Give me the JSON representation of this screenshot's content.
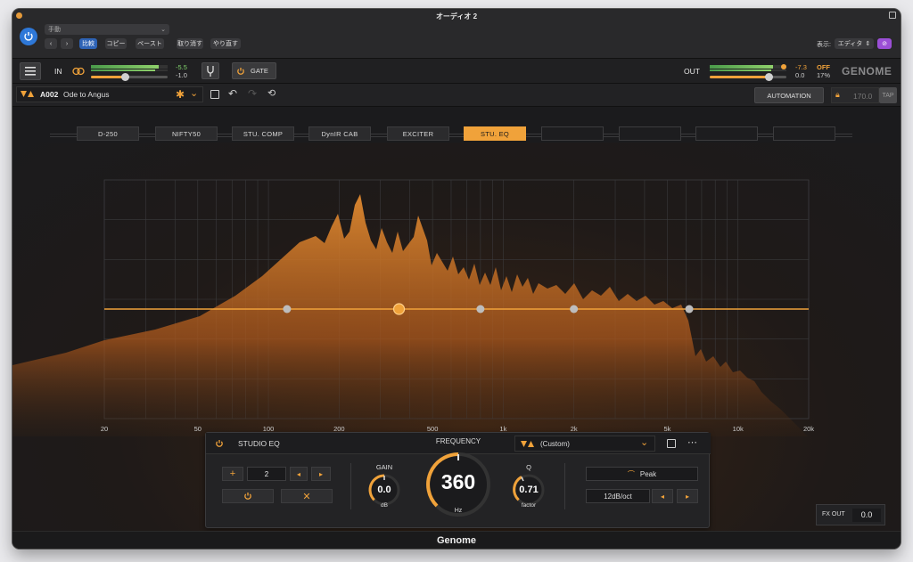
{
  "window": {
    "title": "オーディオ 2",
    "footer_title": "Genome"
  },
  "host": {
    "preset_select": "手動",
    "compare_label": "比較",
    "copy_label": "コピー",
    "paste_label": "ペースト",
    "undo_label": "取り消す",
    "redo_label": "やり直す",
    "view_label": "表示:",
    "view_value": "エディタ"
  },
  "plugin": {
    "in_label": "IN",
    "in_db_top": "-5.5",
    "in_db_bottom": "-1.0",
    "gate_label": "GATE",
    "out_label": "OUT",
    "out_db_top": "-7.3",
    "out_db_bottom": "0.0",
    "off_label": "OFF",
    "off_pct": "17%",
    "brand": "GENOME",
    "preset_id": "A002",
    "preset_name": "Ode to Angus",
    "automation_label": "AUTOMATION",
    "tempo": "170.0",
    "tap_label": "TAP"
  },
  "chain": [
    "D-250",
    "NIFTY50",
    "STU. COMP",
    "DynIR CAB",
    "EXCITER",
    "STU. EQ",
    "",
    "",
    "",
    ""
  ],
  "freq_labels": [
    "20",
    "50",
    "100",
    "200",
    "500",
    "1k",
    "2k",
    "5k",
    "10k",
    "20k"
  ],
  "eq_panel": {
    "title": "STUDIO EQ",
    "band_number": "2",
    "gain_label": "GAIN",
    "gain_value": "0.0",
    "gain_unit": "dB",
    "frequency_label": "FREQUENCY",
    "frequency_value": "360",
    "frequency_unit": "Hz",
    "q_label": "Q",
    "q_value": "0.71",
    "q_unit": "factor",
    "preset_value": "(Custom)",
    "filter_type": "Peak",
    "slope": "12dB/oct"
  },
  "fx_out": {
    "label": "FX OUT",
    "value": "0.0"
  },
  "colors": {
    "accent": "#f0a23a",
    "host_blue": "#2e78d8",
    "purple": "#9b4fd6"
  }
}
